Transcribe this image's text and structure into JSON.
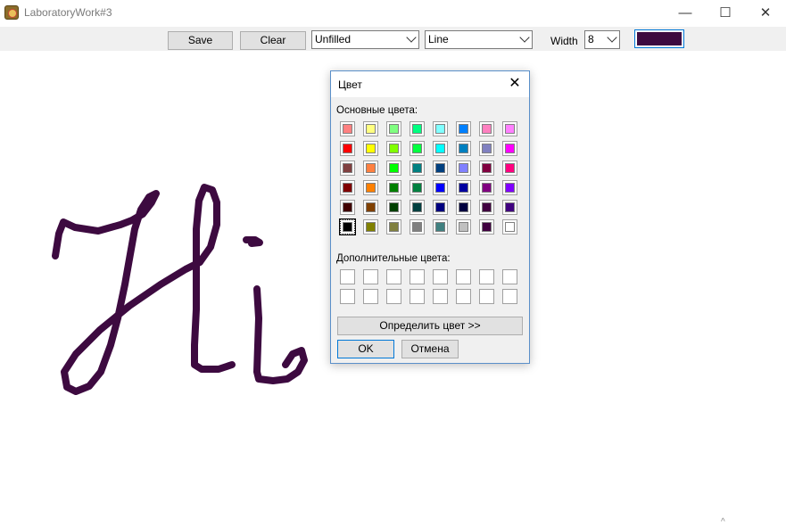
{
  "window": {
    "title": "LaboratoryWork#3",
    "minimize_glyph": "—",
    "maximize_glyph": "☐",
    "close_glyph": "✕"
  },
  "toolbar": {
    "save_label": "Save",
    "clear_label": "Clear",
    "fill_mode": "Unfilled",
    "shape": "Line",
    "width_label": "Width",
    "width_value": "8",
    "current_color": "#3d0a40"
  },
  "canvas": {
    "stroke_color": "#3d0a40",
    "drawing": "handwritten Hi"
  },
  "color_dialog": {
    "title": "Цвет",
    "close_glyph": "✕",
    "basic_colors_label": "Основные цвета:",
    "custom_colors_label": "Дополнительные цвета:",
    "define_button": "Определить цвет >>",
    "ok_button": "OK",
    "cancel_button": "Отмена",
    "selected_color": "#000000",
    "basic_colors": [
      [
        "#ff8080",
        "#ffff80",
        "#80ff80",
        "#00ff80",
        "#80ffff",
        "#0080ff",
        "#ff80c0",
        "#ff80ff"
      ],
      [
        "#ff0000",
        "#ffff00",
        "#80ff00",
        "#00ff40",
        "#00ffff",
        "#0080c0",
        "#8080c0",
        "#ff00ff"
      ],
      [
        "#804040",
        "#ff8040",
        "#00ff00",
        "#008080",
        "#004080",
        "#8080ff",
        "#800040",
        "#ff0080"
      ],
      [
        "#800000",
        "#ff8000",
        "#008000",
        "#008040",
        "#0000ff",
        "#0000a0",
        "#800080",
        "#8000ff"
      ],
      [
        "#400000",
        "#804000",
        "#004000",
        "#004040",
        "#000080",
        "#000040",
        "#400040",
        "#400080"
      ],
      [
        "#000000",
        "#808000",
        "#808040",
        "#808080",
        "#408080",
        "#c0c0c0",
        "#400040",
        "#ffffff"
      ]
    ],
    "custom_colors": [
      [
        "#ffffff",
        "#ffffff",
        "#ffffff",
        "#ffffff",
        "#ffffff",
        "#ffffff",
        "#ffffff",
        "#ffffff"
      ],
      [
        "#ffffff",
        "#ffffff",
        "#ffffff",
        "#ffffff",
        "#ffffff",
        "#ffffff",
        "#ffffff",
        "#ffffff"
      ]
    ]
  },
  "status": {
    "caret_glyph": "^"
  }
}
